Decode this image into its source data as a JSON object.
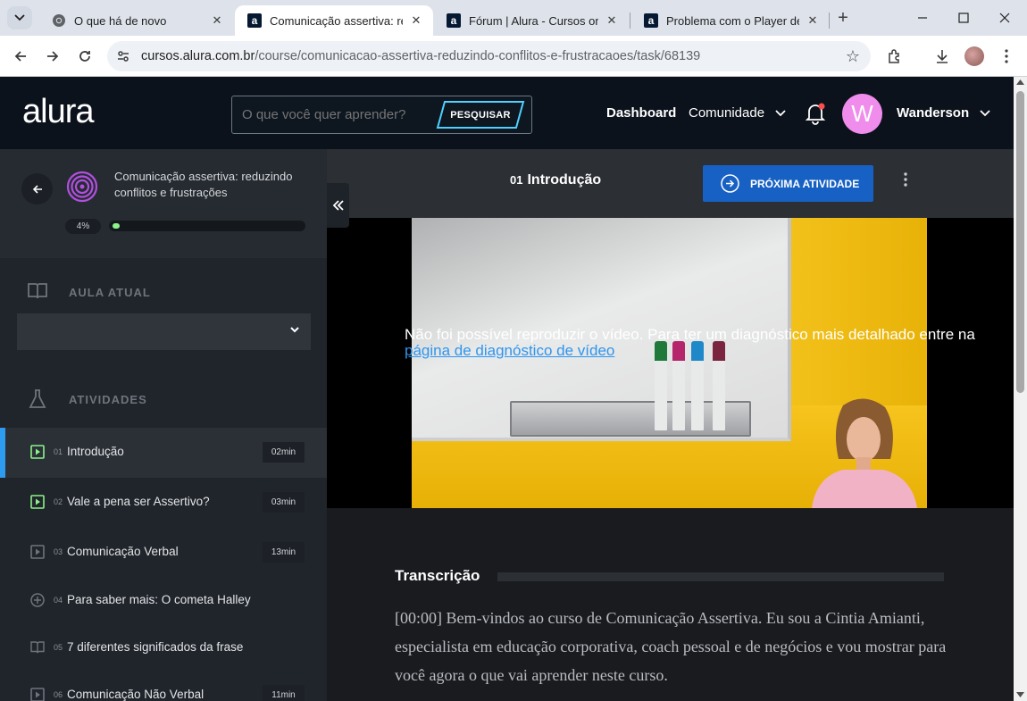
{
  "browser": {
    "tabs": [
      {
        "title": "O que há de novo",
        "favicon": "chrome-icon",
        "active": false
      },
      {
        "title": "Comunicação assertiva: reduzindo",
        "favicon": "alura-icon",
        "active": true
      },
      {
        "title": "Fórum | Alura - Cursos online",
        "favicon": "alura-icon",
        "active": false
      },
      {
        "title": "Problema com o Player de Vídeo",
        "favicon": "alura-icon",
        "active": false
      }
    ],
    "url_domain": "cursos.alura.com.br",
    "url_path": "/course/comunicacao-assertiva-reduzindo-conflitos-e-frustracaoes/task/68139"
  },
  "header": {
    "logo": "alura",
    "search_placeholder": "O que você quer aprender?",
    "search_button": "PESQUISAR",
    "nav_dashboard": "Dashboard",
    "nav_comunidade": "Comunidade",
    "user_initial": "W",
    "user_name": "Wanderson",
    "avatar_color": "#f08cec"
  },
  "sidebar": {
    "course_title": "Comunicação assertiva: reduzindo conflitos e frustrações",
    "progress_label": "4%",
    "progress_value": 0.04,
    "section_current": "AULA ATUAL",
    "section_activities": "ATIVIDADES",
    "activities": [
      {
        "num": "01",
        "name": "Introdução",
        "duration": "02min",
        "icon": "video-done-icon",
        "active": true
      },
      {
        "num": "02",
        "name": "Vale a pena ser Assertivo?",
        "duration": "03min",
        "icon": "video-done-icon",
        "active": false
      },
      {
        "num": "03",
        "name": "Comunicação Verbal",
        "duration": "13min",
        "icon": "video-icon",
        "active": false
      },
      {
        "num": "04",
        "name": "Para saber mais: O cometa Halley",
        "duration": "",
        "icon": "plus-circle-icon",
        "active": false
      },
      {
        "num": "05",
        "name": "7 diferentes significados da frase",
        "duration": "",
        "icon": "book-icon",
        "active": false
      },
      {
        "num": "06",
        "name": "Comunicação Não Verbal",
        "duration": "11min",
        "icon": "video-icon",
        "active": false
      }
    ]
  },
  "main": {
    "lesson_number": "01",
    "lesson_title": "Introdução",
    "next_button": "PRÓXIMA ATIVIDADE",
    "player_error": "Não foi possível reproduzir o vídeo. Para ter um diagnóstico mais detalhado entre na",
    "player_error_link": "página de diagnóstico de vídeo",
    "transcript_title": "Transcrição",
    "transcript_text": "[00:00] Bem-vindos ao curso de Comunicação Assertiva. Eu sou a Cintia Amianti, especialista em educação corporativa, coach pessoal e de negócios e vou mostrar para você agora o que vai aprender neste curso."
  },
  "colors": {
    "accent_blue": "#1761c4",
    "progress_green": "#8df28a",
    "active_bar": "#2d9bf0",
    "done_icon": "#8df28a"
  }
}
